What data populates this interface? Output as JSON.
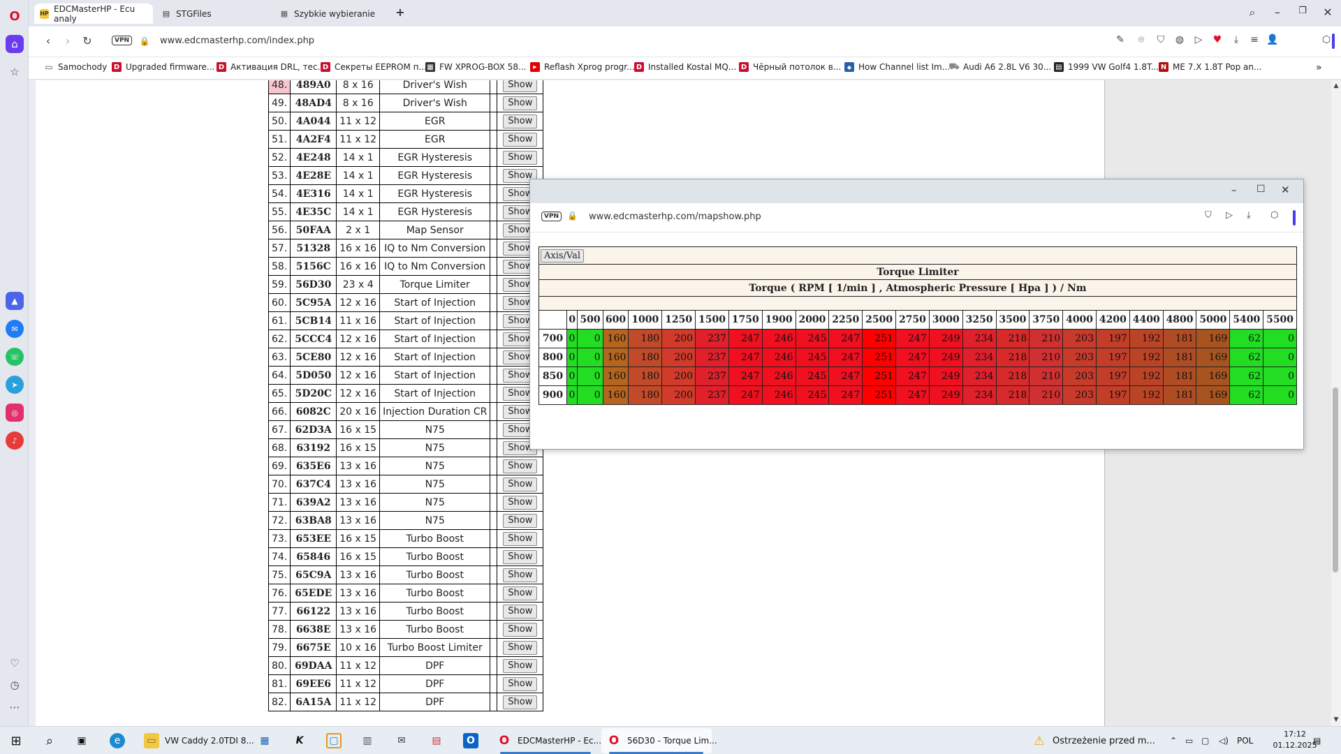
{
  "browser": {
    "tabs": [
      {
        "label": "EDCMasterHP - Ecu analy",
        "icon": "hp-icon",
        "active": true
      },
      {
        "label": "STGFiles",
        "icon": "doc-icon",
        "active": false
      },
      {
        "label": "Szybkie wybieranie",
        "icon": "grid-icon",
        "active": false
      }
    ],
    "new_tab": "+",
    "address": {
      "vpn": "VPN",
      "url": "www.edcmasterhp.com/index.php"
    },
    "bookmarks": [
      {
        "label": "Samochody",
        "icon": "folder-icon",
        "color": "#777777"
      },
      {
        "label": "Upgraded firmware...",
        "icon": "d-icon",
        "color": "#c8102e"
      },
      {
        "label": "Активация DRL, тес...",
        "icon": "d-icon",
        "color": "#c8102e"
      },
      {
        "label": "Секреты EEPROM п...",
        "icon": "d-icon",
        "color": "#c8102e"
      },
      {
        "label": "FW XPROG-BOX 58...",
        "icon": "chip-icon",
        "color": "#333333"
      },
      {
        "label": "Reflash Xprog progr...",
        "icon": "youtube-icon",
        "color": "#e00000"
      },
      {
        "label": "Installed Kostal MQ...",
        "icon": "d-icon",
        "color": "#c8102e"
      },
      {
        "label": "Чёрный потолок в...",
        "icon": "d-icon",
        "color": "#c8102e"
      },
      {
        "label": "How Channel list Im...",
        "icon": "shield-icon",
        "color": "#2b5fa8"
      },
      {
        "label": "Audi A6 2.8L V6 30...",
        "icon": "cart-icon",
        "color": "#888888"
      },
      {
        "label": "1999 VW Golf4 1.8T...",
        "icon": "img-icon",
        "color": "#222222"
      },
      {
        "label": "ME 7.X 1.8T Pop an...",
        "icon": "n-icon",
        "color": "#b01010"
      }
    ]
  },
  "map_list": {
    "show_label": "Show",
    "rows": [
      {
        "num": "48.",
        "addr": "489A0",
        "size": "8 x 16",
        "name": "Driver's Wish",
        "highlight": true
      },
      {
        "num": "49.",
        "addr": "48AD4",
        "size": "8 x 16",
        "name": "Driver's Wish"
      },
      {
        "num": "50.",
        "addr": "4A044",
        "size": "11 x 12",
        "name": "EGR"
      },
      {
        "num": "51.",
        "addr": "4A2F4",
        "size": "11 x 12",
        "name": "EGR"
      },
      {
        "num": "52.",
        "addr": "4E248",
        "size": "14 x 1",
        "name": "EGR Hysteresis"
      },
      {
        "num": "53.",
        "addr": "4E28E",
        "size": "14 x 1",
        "name": "EGR Hysteresis"
      },
      {
        "num": "54.",
        "addr": "4E316",
        "size": "14 x 1",
        "name": "EGR Hysteresis"
      },
      {
        "num": "55.",
        "addr": "4E35C",
        "size": "14 x 1",
        "name": "EGR Hysteresis"
      },
      {
        "num": "56.",
        "addr": "50FAA",
        "size": "2 x 1",
        "name": "Map Sensor"
      },
      {
        "num": "57.",
        "addr": "51328",
        "size": "16 x 16",
        "name": "IQ to Nm Conversion"
      },
      {
        "num": "58.",
        "addr": "5156C",
        "size": "16 x 16",
        "name": "IQ to Nm Conversion"
      },
      {
        "num": "59.",
        "addr": "56D30",
        "size": "23 x 4",
        "name": "Torque Limiter"
      },
      {
        "num": "60.",
        "addr": "5C95A",
        "size": "12 x 16",
        "name": "Start of Injection"
      },
      {
        "num": "61.",
        "addr": "5CB14",
        "size": "11 x 16",
        "name": "Start of Injection"
      },
      {
        "num": "62.",
        "addr": "5CCC4",
        "size": "12 x 16",
        "name": "Start of Injection"
      },
      {
        "num": "63.",
        "addr": "5CE80",
        "size": "12 x 16",
        "name": "Start of Injection"
      },
      {
        "num": "64.",
        "addr": "5D050",
        "size": "12 x 16",
        "name": "Start of Injection"
      },
      {
        "num": "65.",
        "addr": "5D20C",
        "size": "12 x 16",
        "name": "Start of Injection"
      },
      {
        "num": "66.",
        "addr": "6082C",
        "size": "20 x 16",
        "name": "Injection Duration CR"
      },
      {
        "num": "67.",
        "addr": "62D3A",
        "size": "16 x 15",
        "name": "N75"
      },
      {
        "num": "68.",
        "addr": "63192",
        "size": "16 x 15",
        "name": "N75"
      },
      {
        "num": "69.",
        "addr": "635E6",
        "size": "13 x 16",
        "name": "N75"
      },
      {
        "num": "70.",
        "addr": "637C4",
        "size": "13 x 16",
        "name": "N75"
      },
      {
        "num": "71.",
        "addr": "639A2",
        "size": "13 x 16",
        "name": "N75"
      },
      {
        "num": "72.",
        "addr": "63BA8",
        "size": "13 x 16",
        "name": "N75"
      },
      {
        "num": "73.",
        "addr": "653EE",
        "size": "16 x 15",
        "name": "Turbo Boost"
      },
      {
        "num": "74.",
        "addr": "65846",
        "size": "16 x 15",
        "name": "Turbo Boost"
      },
      {
        "num": "75.",
        "addr": "65C9A",
        "size": "13 x 16",
        "name": "Turbo Boost"
      },
      {
        "num": "76.",
        "addr": "65EDE",
        "size": "13 x 16",
        "name": "Turbo Boost"
      },
      {
        "num": "77.",
        "addr": "66122",
        "size": "13 x 16",
        "name": "Turbo Boost"
      },
      {
        "num": "78.",
        "addr": "6638E",
        "size": "13 x 16",
        "name": "Turbo Boost"
      },
      {
        "num": "79.",
        "addr": "6675E",
        "size": "10 x 16",
        "name": "Turbo Boost Limiter"
      },
      {
        "num": "80.",
        "addr": "69DAA",
        "size": "11 x 12",
        "name": "DPF"
      },
      {
        "num": "81.",
        "addr": "69EE6",
        "size": "11 x 12",
        "name": "DPF"
      },
      {
        "num": "82.",
        "addr": "6A15A",
        "size": "11 x 12",
        "name": "DPF"
      }
    ]
  },
  "popup": {
    "vpn": "VPN",
    "url": "www.edcmasterhp.com/mapshow.php",
    "axis_button": "Axis/Val",
    "title": "Torque Limiter",
    "subtitle": "Torque ( RPM [ 1/min ] , Atmospheric Pressure [ Hpa ] ) / Nm",
    "x_axis": [
      "0",
      "500",
      "600",
      "1000",
      "1250",
      "1500",
      "1750",
      "1900",
      "2000",
      "2250",
      "2500",
      "2750",
      "3000",
      "3250",
      "3500",
      "3750",
      "4000",
      "4200",
      "4400",
      "4800",
      "5000",
      "5400",
      "5500"
    ],
    "y_axis": [
      "700",
      "800",
      "850",
      "900"
    ],
    "row_values": [
      "0",
      "0",
      "160",
      "180",
      "200",
      "237",
      "247",
      "246",
      "245",
      "247",
      "251",
      "247",
      "249",
      "234",
      "218",
      "210",
      "203",
      "197",
      "192",
      "181",
      "169",
      "62",
      "0"
    ],
    "cell_colors": [
      "#22dd22",
      "#22dd22",
      "#b5651d",
      "#c04a2a",
      "#d23a2a",
      "#e0202a",
      "#f0101f",
      "#f0101f",
      "#f0101f",
      "#f0101f",
      "#ff0000",
      "#f0101f",
      "#f0101f",
      "#e0202a",
      "#d82a2a",
      "#d03030",
      "#c83a2a",
      "#c23e28",
      "#bb4426",
      "#b04c24",
      "#a85420",
      "#22dd22",
      "#22dd22"
    ]
  },
  "taskbar": {
    "items": [
      {
        "label": "VW Caddy 2.0TDI 8...",
        "icon": "folder-icon",
        "color": "#f2c744"
      },
      {
        "label": "EDCMasterHP - Ec...",
        "icon": "opera-icon",
        "color": "#e0102a"
      },
      {
        "label": "56D30 - Torque Lim...",
        "icon": "opera-icon",
        "color": "#e0102a"
      }
    ],
    "notification": "Ostrzeżenie przed m...",
    "lang": "POL",
    "time": "17:12",
    "date": "01.12.2025"
  }
}
